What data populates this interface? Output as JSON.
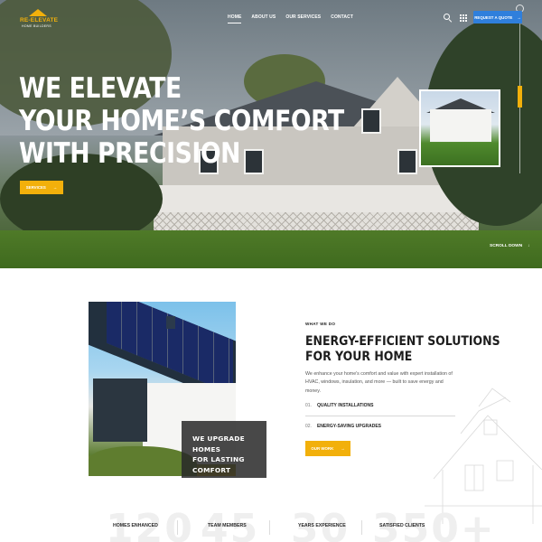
{
  "brand": {
    "name": "RE-ELEVATE",
    "tagline": "HOME BUILDERS",
    "accent_color": "#f2b00b",
    "primary_blue": "#2f7fdc"
  },
  "nav": {
    "items": [
      {
        "label": "HOME",
        "active": true
      },
      {
        "label": "ABOUT US",
        "active": false
      },
      {
        "label": "OUR SERVICES",
        "active": false
      },
      {
        "label": "CONTACT",
        "active": false
      }
    ],
    "search_icon": "search-icon",
    "menu_icon": "grid-menu-icon",
    "cta_label": "REQUEST A QUOTE",
    "cta_icon": "arrow-right-icon"
  },
  "hero": {
    "title_lines": [
      "WE ELEVATE",
      "YOUR HOME’S COMFORT",
      "WITH PRECISION"
    ],
    "button_label": "SERVICES",
    "button_icon": "arrow-right-icon",
    "scroll_label": "SCROLL DOWN",
    "scroll_icon": "arrow-down-icon"
  },
  "about": {
    "overlay_lines": [
      "WE UPGRADE HOMES",
      "FOR LASTING",
      "COMFORT"
    ],
    "eyebrow": "WHAT WE DO",
    "title_lines": [
      "ENERGY-EFFICIENT SOLUTIONS",
      "FOR YOUR HOME"
    ],
    "description": "We enhance your home's comfort and value with expert installation of HVAC, windows, insulation, and more — built to save energy and money.",
    "features": [
      {
        "number": "01.",
        "label": "QUALITY INSTALLATIONS"
      },
      {
        "number": "02.",
        "label": "ENERGY-SAVING UPGRADES"
      }
    ],
    "button_label": "OUR WORK",
    "button_icon": "arrow-right-icon"
  },
  "stats": [
    {
      "value": "120",
      "label": "HOMES ENHANCED"
    },
    {
      "value": "45",
      "label": "TEAM MEMBERS"
    },
    {
      "value": "30",
      "label": "YEARS EXPERIENCE"
    },
    {
      "value": "350+",
      "label": "SATISFIED CLIENTS"
    }
  ]
}
